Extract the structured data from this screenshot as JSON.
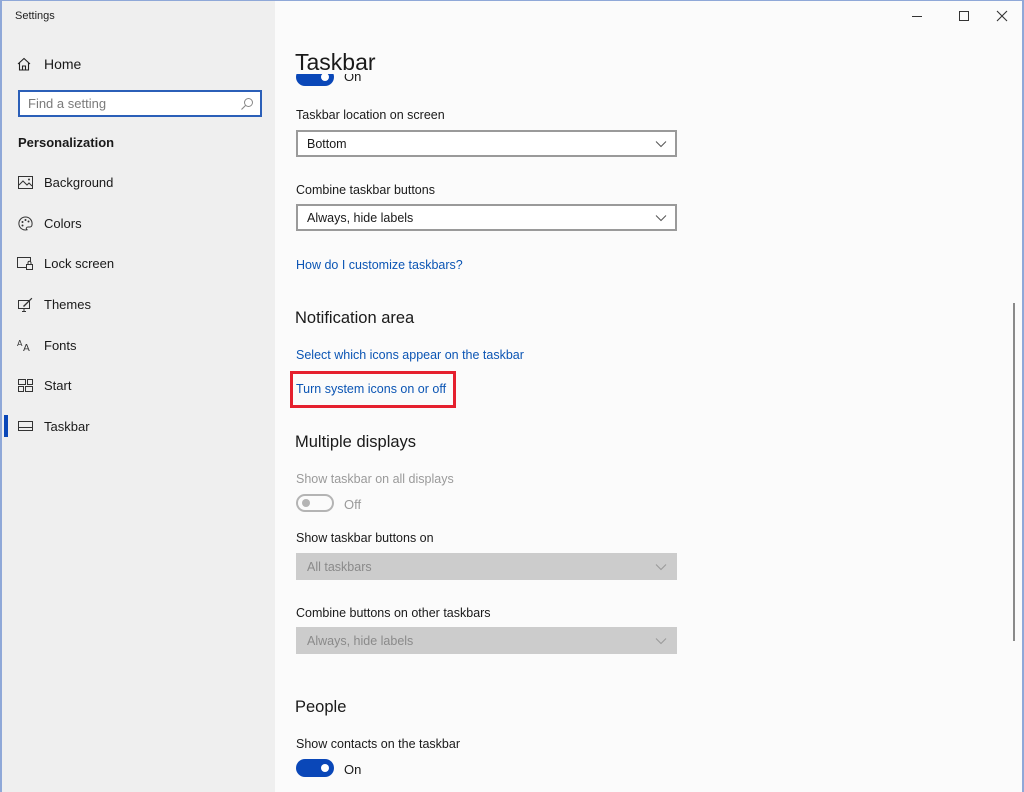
{
  "window": {
    "title": "Settings",
    "controls": {
      "minimize": "minimize-icon",
      "maximize": "maximize-icon",
      "close": "close-icon"
    }
  },
  "sidebar": {
    "home_label": "Home",
    "search_placeholder": "Find a setting",
    "section_title": "Personalization",
    "items": [
      {
        "label": "Background",
        "icon": "picture-icon",
        "active": false
      },
      {
        "label": "Colors",
        "icon": "palette-icon",
        "active": false
      },
      {
        "label": "Lock screen",
        "icon": "lock-screen-icon",
        "active": false
      },
      {
        "label": "Themes",
        "icon": "themes-brush-icon",
        "active": false
      },
      {
        "label": "Fonts",
        "icon": "fonts-icon",
        "active": false
      },
      {
        "label": "Start",
        "icon": "start-tiles-icon",
        "active": false
      },
      {
        "label": "Taskbar",
        "icon": "taskbar-icon",
        "active": true
      }
    ]
  },
  "main": {
    "page_title": "Taskbar",
    "top_toggle": {
      "state_label": "On",
      "on": true
    },
    "taskbar_location": {
      "label": "Taskbar location on screen",
      "value": "Bottom"
    },
    "combine_buttons": {
      "label": "Combine taskbar buttons",
      "value": "Always, hide labels"
    },
    "customize_link": "How do I customize taskbars?",
    "notification_area": {
      "heading": "Notification area",
      "select_icons_link": "Select which icons appear on the taskbar",
      "system_icons_link": "Turn system icons on or off"
    },
    "multiple_displays": {
      "heading": "Multiple displays",
      "show_all_label": "Show taskbar on all displays",
      "show_all_state": "Off",
      "show_buttons_label": "Show taskbar buttons on",
      "show_buttons_value": "All taskbars",
      "combine_other_label": "Combine buttons on other taskbars",
      "combine_other_value": "Always, hide labels"
    },
    "people": {
      "heading": "People",
      "contacts_label": "Show contacts on the taskbar",
      "contacts_state": "On"
    }
  },
  "colors": {
    "accent": "#0a47b8",
    "link": "#0b55b4",
    "highlight_box": "#e5202e",
    "sidebar_bg": "#efefef"
  }
}
